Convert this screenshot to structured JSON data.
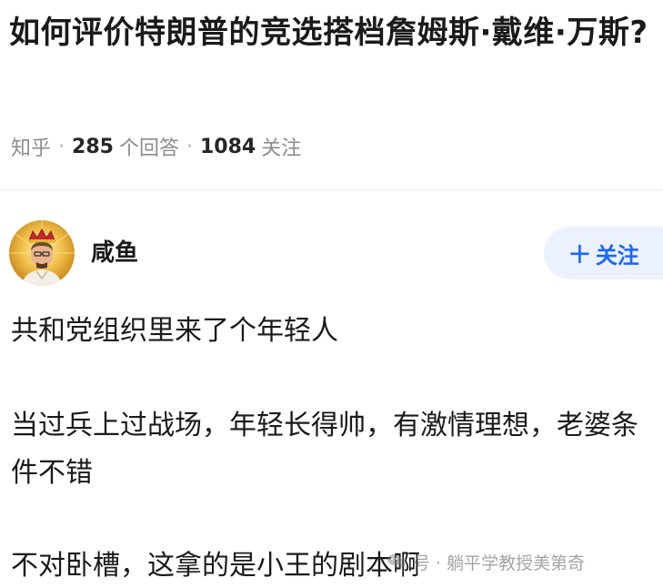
{
  "question": {
    "title": "如何评价特朗普的竞选搭档詹姆斯·戴维·万斯?"
  },
  "meta": {
    "source": "知乎",
    "answers_count": "285",
    "answers_label": "个回答",
    "followers_count": "1084",
    "followers_label": "关注",
    "separator": "·"
  },
  "author": {
    "name": "咸鱼",
    "avatar": "avatar-icon"
  },
  "follow_button": {
    "icon": "plus-icon",
    "label": "关注",
    "color": "#1766ff",
    "background": "#ebf2fd"
  },
  "answer": {
    "paragraphs": [
      "共和党组织里来了个年轻人",
      "当过兵上过战场，年轻长得帅，有激情理想，老婆条件不错",
      "不对卧槽，这拿的是小王的剧本啊"
    ]
  },
  "watermark": {
    "icon": "wechat-icon",
    "text": "号 · 躺平学教授美第奇"
  }
}
